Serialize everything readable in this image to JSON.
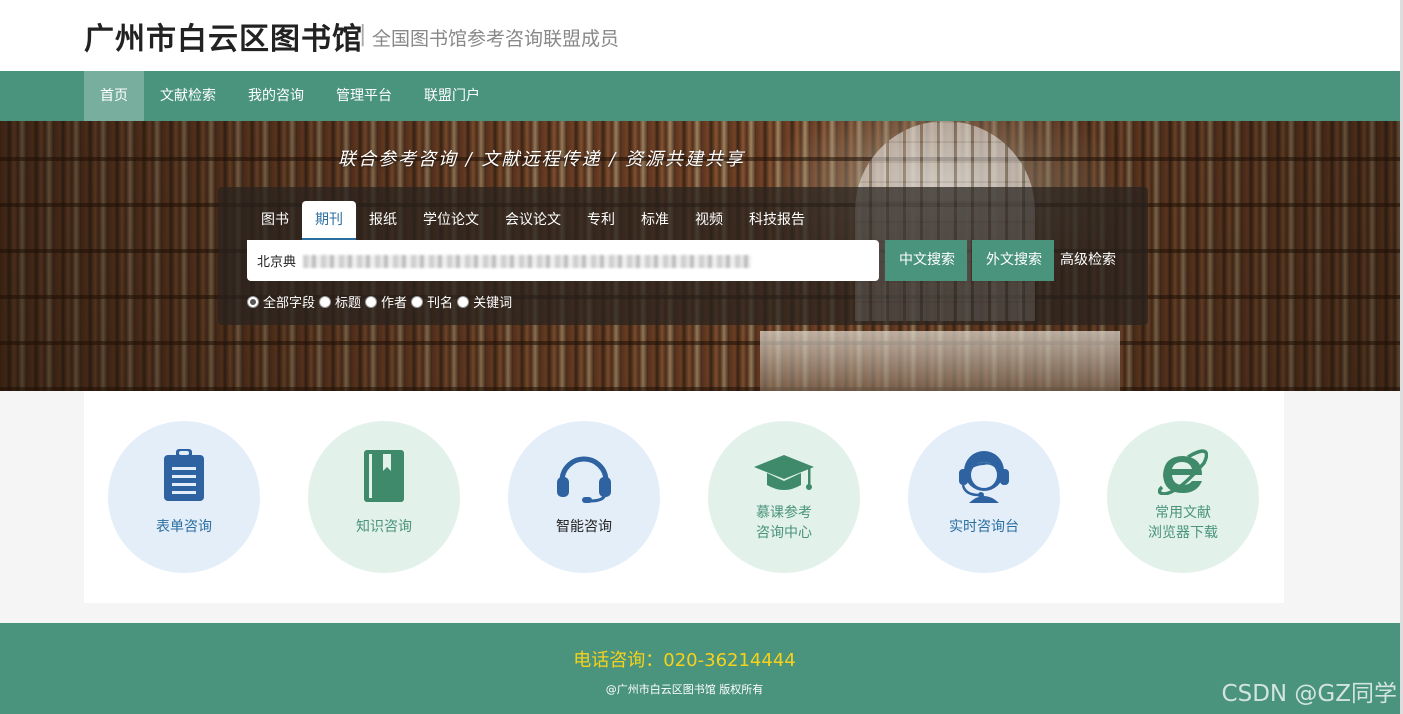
{
  "header": {
    "title": "广州市白云区图书馆",
    "separator": "|",
    "subtitle": "全国图书馆参考咨询联盟成员"
  },
  "nav": {
    "items": [
      {
        "label": "首页",
        "active": true
      },
      {
        "label": "文献检索"
      },
      {
        "label": "我的咨询"
      },
      {
        "label": "管理平台"
      },
      {
        "label": "联盟门户"
      }
    ]
  },
  "banner": {
    "slogan": "联合参考咨询 / 文献远程传递 / 资源共建共享"
  },
  "search": {
    "tabs": [
      {
        "label": "图书"
      },
      {
        "label": "期刊",
        "active": true
      },
      {
        "label": "报纸"
      },
      {
        "label": "学位论文"
      },
      {
        "label": "会议论文"
      },
      {
        "label": "专利"
      },
      {
        "label": "标准"
      },
      {
        "label": "视频"
      },
      {
        "label": "科技报告"
      }
    ],
    "input_value": "北京典",
    "btn_chinese": "中文搜索",
    "btn_foreign": "外文搜索",
    "advanced": "高级检索",
    "fields": [
      {
        "label": "全部字段",
        "checked": true
      },
      {
        "label": "标题"
      },
      {
        "label": "作者"
      },
      {
        "label": "刊名"
      },
      {
        "label": "关键词"
      }
    ]
  },
  "services": [
    {
      "line1": "表单咨询",
      "line2": "",
      "icon": "clipboard-icon",
      "theme": "blue"
    },
    {
      "line1": "知识咨询",
      "line2": "",
      "icon": "book-icon",
      "theme": "green"
    },
    {
      "line1": "智能咨询",
      "line2": "",
      "icon": "headset-icon",
      "theme": "blue"
    },
    {
      "line1": "慕课参考",
      "line2": "咨询中心",
      "icon": "graduation-cap-icon",
      "theme": "green"
    },
    {
      "line1": "实时咨询台",
      "line2": "",
      "icon": "agent-icon",
      "theme": "blue"
    },
    {
      "line1": "常用文献",
      "line2": "浏览器下载",
      "icon": "browser-e-icon",
      "theme": "green"
    }
  ],
  "footer": {
    "phone": "电话咨询：020-36214444",
    "copyright": "@广州市白云区图书馆 版权所有"
  },
  "watermark": "CSDN @GZ同学",
  "colors": {
    "primary_green": "#4a937d",
    "accent_blue": "#2b6fa0",
    "phone_yellow": "#f7d21b"
  }
}
